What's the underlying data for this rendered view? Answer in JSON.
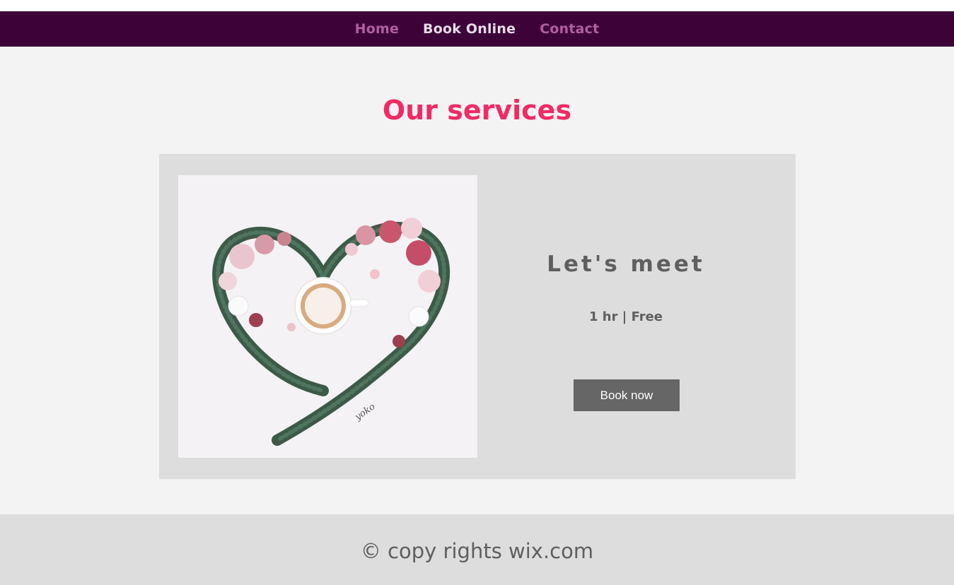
{
  "nav": {
    "items": [
      {
        "label": "Home"
      },
      {
        "label": "Book Online"
      },
      {
        "label": "Contact"
      }
    ]
  },
  "main": {
    "title": "Our services",
    "service": {
      "name": "Let's meet",
      "details": "1 hr | Free",
      "button_label": "Book now",
      "image_signature": "yoko"
    }
  },
  "footer": {
    "text": "© copy rights wix.com"
  },
  "colors": {
    "nav_bg": "#3d0339",
    "nav_link": "#b05fa0",
    "nav_active": "#e8dce8",
    "title": "#f22a63",
    "card_bg": "#dddddd",
    "button_bg": "#666666",
    "text_gray": "#5f5f5f",
    "page_bg": "#f3f3f3"
  },
  "icons": {
    "service_image": "heart-wreath-coffee-image"
  }
}
